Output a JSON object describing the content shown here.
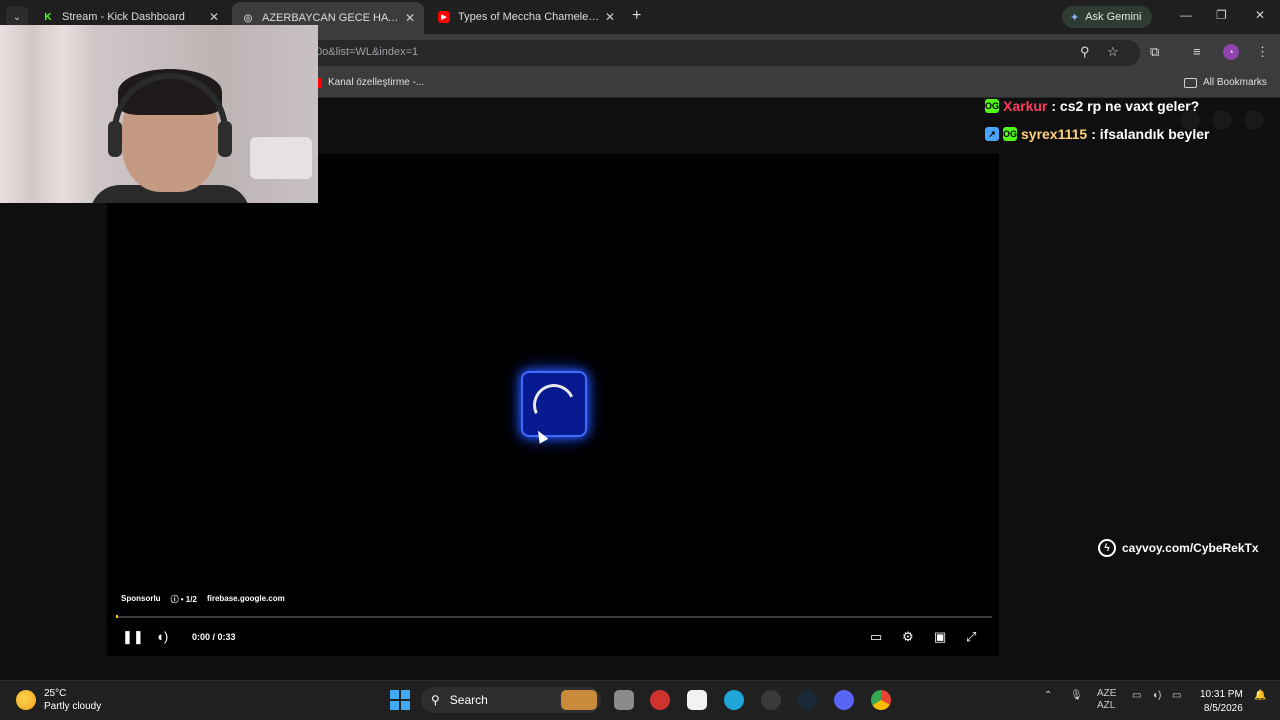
{
  "tabs": [
    {
      "title": "Stream - Kick Dashboard",
      "favicon": "K"
    },
    {
      "title": "AZERBAYCAN GECE HAYATI",
      "favicon": "◎"
    },
    {
      "title": "Types of Meccha Chameleon PL",
      "favicon": "▶"
    }
  ],
  "gemini_label": "Ask Gemini",
  "address_fragment": "0o&list=WL&index=1",
  "bookmark": "Kanal özelleştirme -...",
  "all_bookmarks": "All Bookmarks",
  "player": {
    "sponsor": "Sponsorlu",
    "ad_count": "ⓘ • 1/2",
    "ad_domain": "firebase.google.com",
    "time": "0:00 / 0:33",
    "progress": 0.0
  },
  "chat": [
    {
      "user": "Xarkur",
      "message": ": cs2 rp ne vaxt geler?",
      "color": "#ff3b5c"
    },
    {
      "user": "syrex1115",
      "message": ": ifsalandık beyler",
      "color": "#ffd37a"
    }
  ],
  "promo_link": "cayvoy.com/CybeRekTx",
  "taskbar": {
    "temp": "25°C",
    "weather": "Partly cloudy",
    "search": "Search",
    "lang_top": "AZE",
    "lang_bottom": "AZL",
    "time": "10:31 PM",
    "date": "8/5/2026"
  },
  "colors": {
    "accent_blue": "#3f6bff",
    "kick_green": "#53fc18"
  }
}
